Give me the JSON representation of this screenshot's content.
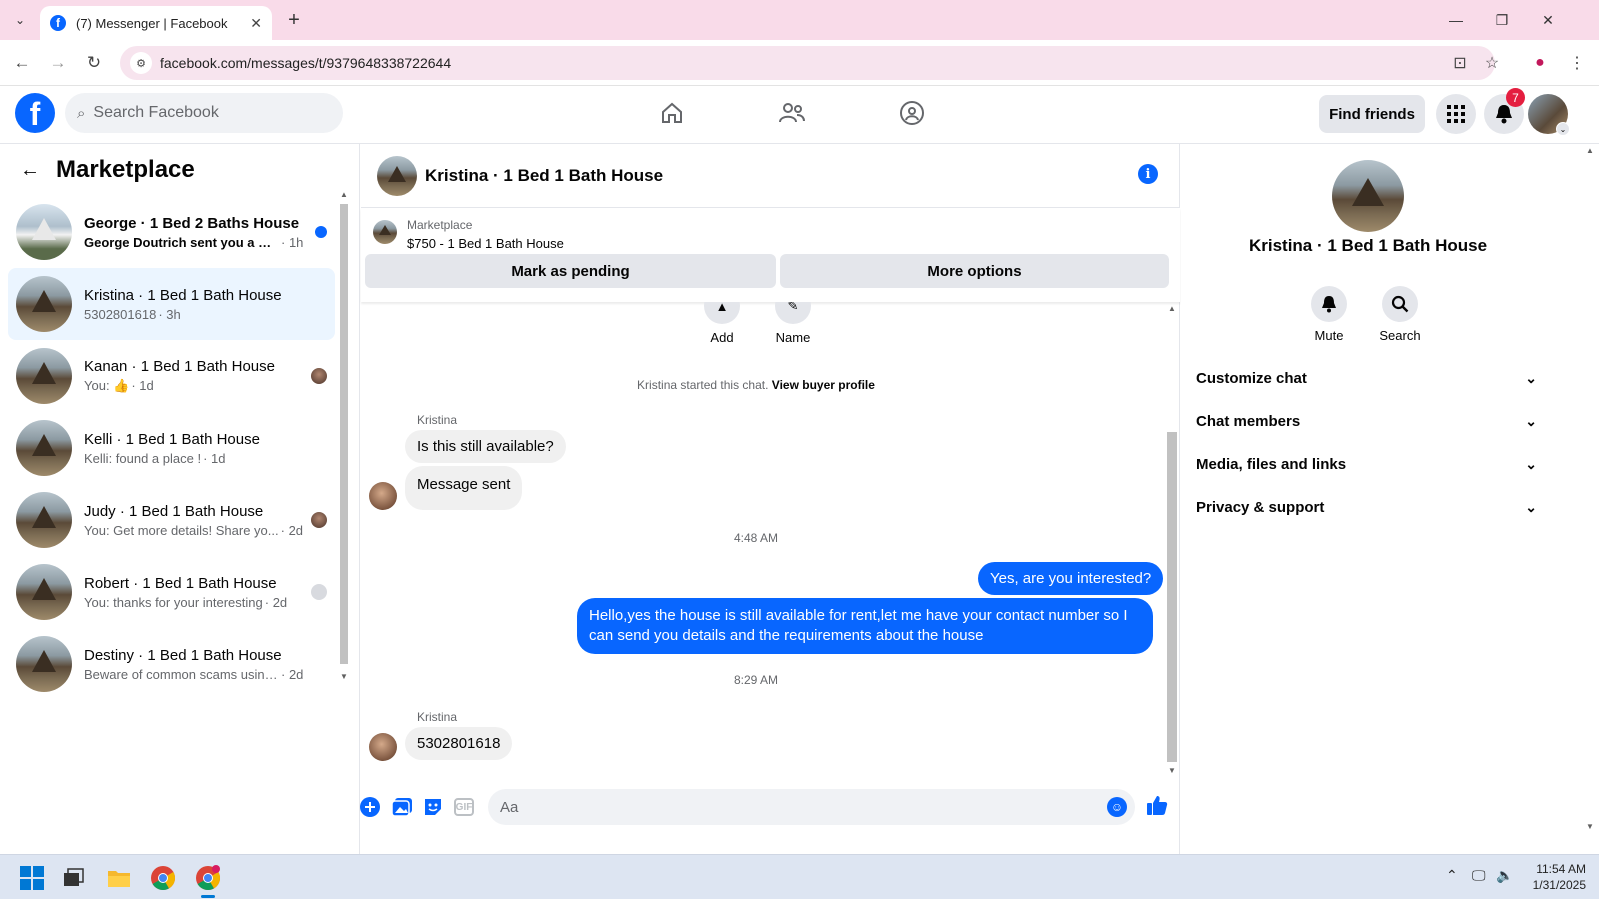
{
  "browser": {
    "tab_title": "(7) Messenger | Facebook",
    "url": "facebook.com/messages/t/9379648338722644"
  },
  "fb": {
    "search_placeholder": "Search Facebook",
    "find_friends": "Find friends",
    "notif_count": "7"
  },
  "left": {
    "title": "Marketplace",
    "conversations": [
      {
        "name": "George · 1 Bed 2 Baths House",
        "preview": "George Doutrich sent you a me...",
        "time": "· 1h"
      },
      {
        "name": "Kristina · 1 Bed 1 Bath House",
        "preview": "5302801618",
        "time": "· 3h"
      },
      {
        "name": "Kanan · 1 Bed 1 Bath House",
        "preview": "You: 👍",
        "time": "· 1d"
      },
      {
        "name": "Kelli · 1 Bed 1 Bath House",
        "preview": "Kelli: found a place !",
        "time": "· 1d"
      },
      {
        "name": "Judy · 1 Bed 1 Bath House",
        "preview": "You: Get more details! Share yo...",
        "time": "· 2d"
      },
      {
        "name": "Robert · 1 Bed 1 Bath House",
        "preview": "You: thanks for your interesting",
        "time": "· 2d"
      },
      {
        "name": "Destiny · 1 Bed 1 Bath House",
        "preview": "Beware of common scams using p...",
        "time": "· 2d"
      }
    ]
  },
  "chat": {
    "title": "Kristina · 1 Bed 1 Bath House",
    "listing_source": "Marketplace",
    "listing_price": "$750 - 1 Bed 1 Bath House",
    "mark_pending": "Mark as pending",
    "more_options": "More options",
    "action_add": "Add",
    "action_name": "Name",
    "started_text": "Kristina started this chat.",
    "view_buyer": "View buyer profile",
    "sender_name": "Kristina",
    "msg1": "Is this still available?",
    "msg2": "Message sent",
    "time1": "4:48 AM",
    "out1": "Yes, are you interested?",
    "out2": "Hello,yes the house is still available for rent,let me have your contact number   so I can send you details and the requirements about the house",
    "time2": "8:29 AM",
    "sender_name2": "Kristina",
    "msg3": "5302801618",
    "input_placeholder": "Aa",
    "gif_label": "GIF"
  },
  "right": {
    "title": "Kristina · 1 Bed 1 Bath House",
    "mute": "Mute",
    "search": "Search",
    "sections": [
      "Customize chat",
      "Chat members",
      "Media, files and links",
      "Privacy & support"
    ]
  },
  "taskbar": {
    "time": "11:54 AM",
    "date": "1/31/2025"
  }
}
